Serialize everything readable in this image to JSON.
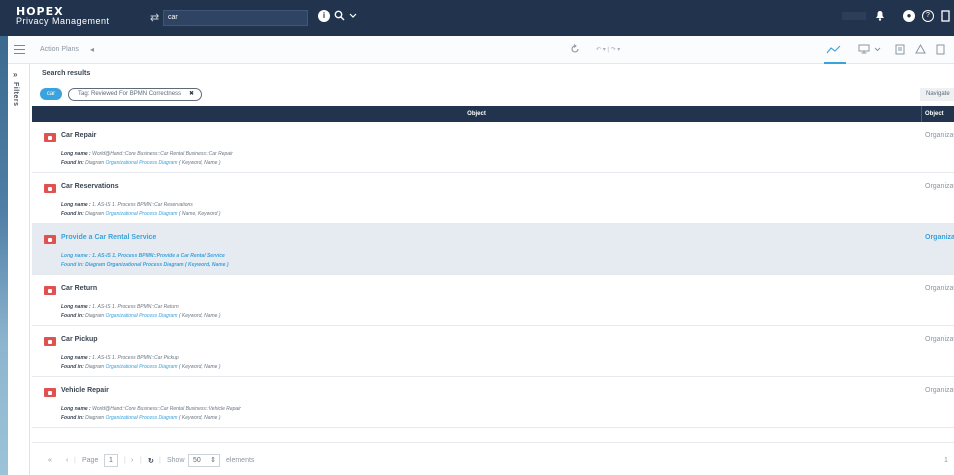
{
  "app": {
    "logo": "HOPEX",
    "subtitle": "Privacy Management"
  },
  "search": {
    "separator": "⇄",
    "query": "car"
  },
  "topbar_icons": [
    "info-icon",
    "search-icon",
    "chevron-down-icon",
    "bell-icon",
    "user-icon",
    "help-icon",
    "exit-icon"
  ],
  "toolbar": {
    "breadcrumb": "Action Plans",
    "back": "◂",
    "undo_redo": "↶ ▾ | ↷ ▾"
  },
  "filters": {
    "chevron": "»",
    "label": "Filters"
  },
  "results": {
    "title": "Search results",
    "tag_car": "car",
    "tag_reviewed": "Tag: Reviewed For BPMN Correctness",
    "tag_remove": "✖",
    "navigate": "Navigate"
  },
  "table": {
    "col_object": "Object",
    "col_type": "Object type",
    "rows": [
      {
        "title": "Car Repair",
        "long_label": "Long name :",
        "long_value": " World@Hand::Core Business::Car Rental Business::Car Repair",
        "found_label": "Found in:",
        "found_value": " Diagram ",
        "found_diagram": "Organizational Process Diagram",
        "found_suffix": " ( Keyword, Name )",
        "type": "Organizational",
        "selected": false
      },
      {
        "title": "Car Reservations",
        "long_label": "Long name :",
        "long_value": " 1. AS-IS 1. Process BPMN::Car Reservations",
        "found_label": "Found in:",
        "found_value": " Diagram ",
        "found_diagram": "Organizational Process Diagram",
        "found_suffix": " ( Name, Keyword )",
        "type": "Organizational",
        "selected": false
      },
      {
        "title": "Provide a Car Rental Service",
        "long_label": "Long name :",
        "long_value": " 1. AS-IS 1. Process BPMN::Provide a Car Rental Service",
        "found_label": "Found in:",
        "found_value": " Diagram ",
        "found_diagram": "Organizational Process Diagram",
        "found_suffix": " ( Keyword, Name )",
        "type": "Organizational",
        "selected": true
      },
      {
        "title": "Car Return",
        "long_label": "Long name :",
        "long_value": " 1. AS-IS 1. Process BPMN::Car Return",
        "found_label": "Found in:",
        "found_value": " Diagram ",
        "found_diagram": "Organizational Process Diagram",
        "found_suffix": " ( Keyword, Name )",
        "type": "Organizational",
        "selected": false
      },
      {
        "title": "Car Pickup",
        "long_label": "Long name :",
        "long_value": " 1. AS-IS 1. Process BPMN::Car Pickup",
        "found_label": "Found in:",
        "found_value": " Diagram ",
        "found_diagram": "Organizational Process Diagram",
        "found_suffix": " ( Keyword, Name )",
        "type": "Organizational",
        "selected": false
      },
      {
        "title": "Vehicle Repair",
        "long_label": "Long name :",
        "long_value": " World@Hand::Core Business::Car Rental Business::Vehicle Repair",
        "found_label": "Found in:",
        "found_value": " Diagram ",
        "found_diagram": "Organizational Process Diagram",
        "found_suffix": " ( Keyword, Name )",
        "type": "Organizational",
        "selected": false
      }
    ]
  },
  "pager": {
    "first": "«",
    "prev": "‹",
    "page_label": "Page",
    "page_value": "1",
    "next": "›",
    "refresh": "↻",
    "show_label": "Show",
    "page_size": "50",
    "elements_label": "elements",
    "total": "1"
  },
  "colors": {
    "topbar": "#22344d",
    "accent": "#3aa2dc",
    "object_icon": "#e0524f",
    "selected_row": "#e6ebf2"
  }
}
